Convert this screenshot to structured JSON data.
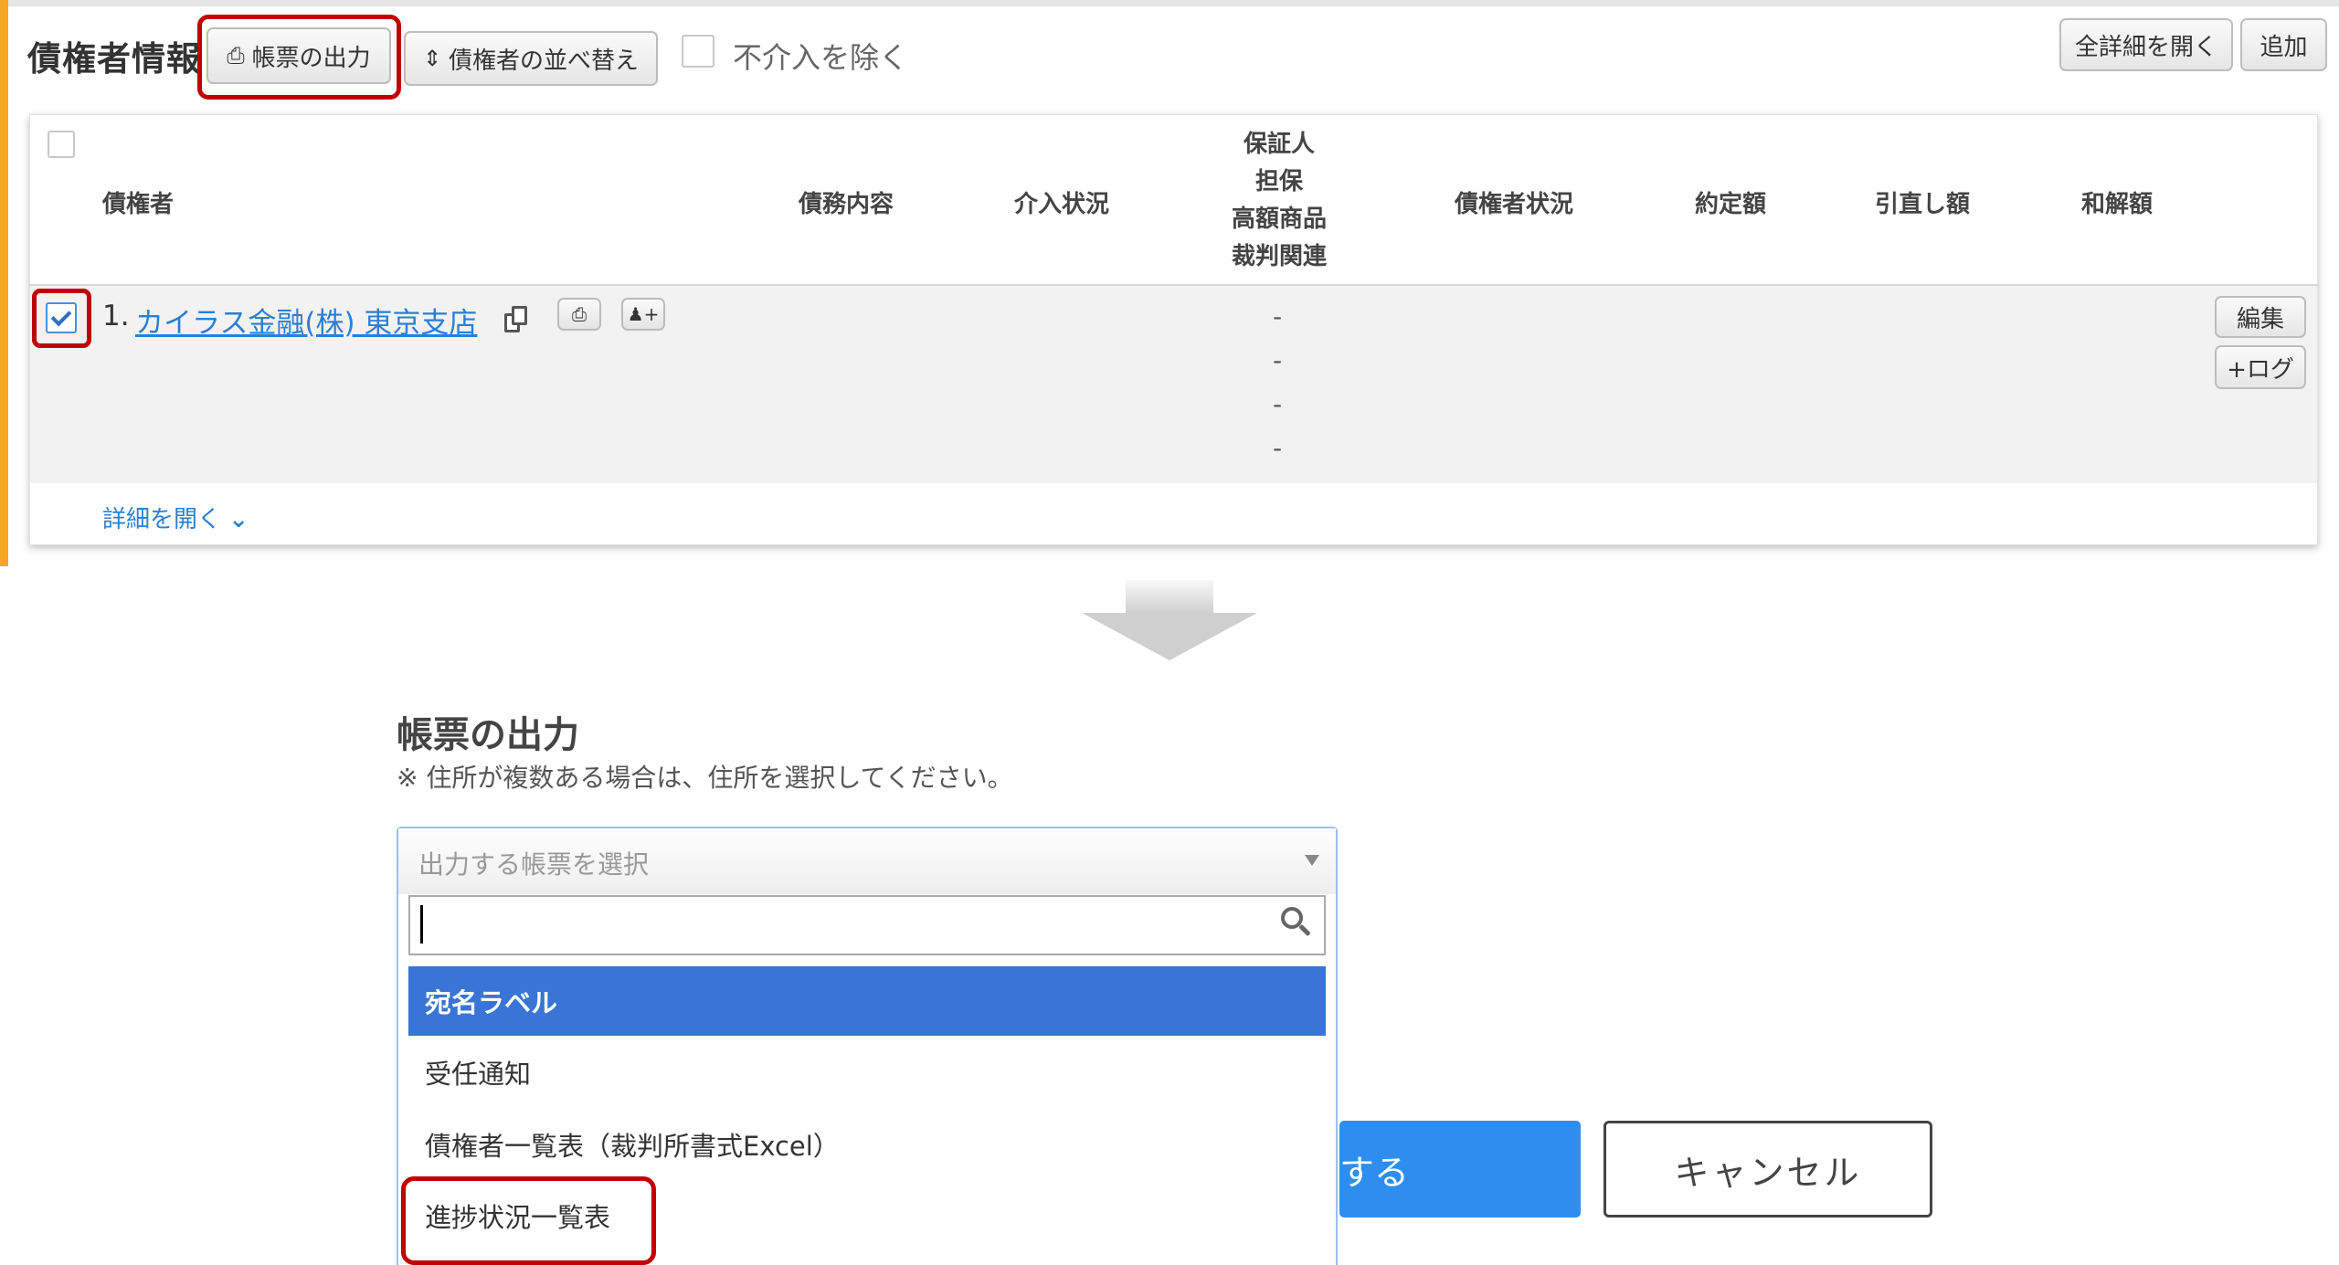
{
  "panel": {
    "title": "債権者情報",
    "print_button": "帳票の出力",
    "sort_button": "債権者の並べ替え",
    "exclude_label": "不介入を除く",
    "open_all_button": "全詳細を開く",
    "add_button": "追加"
  },
  "table": {
    "headers": {
      "creditor": "債権者",
      "debt": "債務内容",
      "intervention": "介入状況",
      "guarantee_lines": [
        "保証人",
        "担保",
        "高額商品",
        "裁判関連"
      ],
      "creditor_status": "債権者状況",
      "fixed_amount": "約定額",
      "withdrawal_amount": "引直し額",
      "settlement_amount": "和解額"
    },
    "rows": [
      {
        "number": "1.",
        "name": "カイラス金融(株) 東京支店",
        "checked": true,
        "guarantee_values": [
          "-",
          "-",
          "-",
          "-"
        ],
        "edit_button": "編集",
        "log_button": "+ログ"
      }
    ],
    "detail_link": "詳細を開く"
  },
  "dialog": {
    "title": "帳票の出力",
    "note": "※ 住所が複数ある場合は、住所を選択してください。",
    "select_placeholder": "出力する帳票を選択",
    "search_value": "",
    "options": [
      "宛名ラベル",
      "受任通知",
      "債権者一覧表（裁判所書式Excel）",
      "進捗状況一覧表"
    ],
    "active_option_index": 0,
    "submit_button_partial": "する",
    "cancel_button": "キャンセル"
  },
  "colors": {
    "accent_orange": "#f5a623",
    "highlight_red": "#c00000",
    "link_blue": "#2a7fd4",
    "option_active": "#3875d7",
    "submit_blue": "#2e8ef0"
  }
}
